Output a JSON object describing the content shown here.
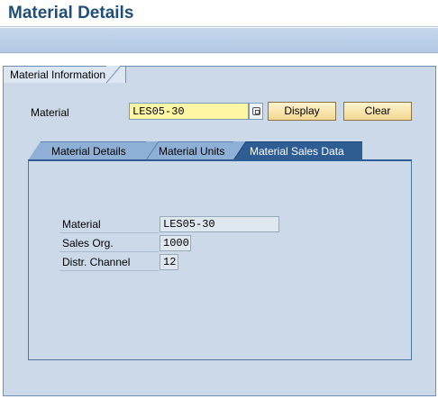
{
  "page": {
    "title": "Material Details"
  },
  "group": {
    "caption": "Material Information"
  },
  "material_field": {
    "label": "Material",
    "value": "LES05-30"
  },
  "buttons": {
    "display": "Display",
    "clear": "Clear"
  },
  "tabs": [
    {
      "label": "Material Details",
      "active": false
    },
    {
      "label": "Material Units",
      "active": false
    },
    {
      "label": "Material Sales Data",
      "active": true
    }
  ],
  "sales_data": {
    "rows": [
      {
        "label": "Material",
        "value": "LES05-30"
      },
      {
        "label": "Sales Org.",
        "value": "1000"
      },
      {
        "label": "Distr. Channel",
        "value": "12"
      }
    ]
  },
  "colors": {
    "title": "#1f4e79",
    "active_tab": "#2e5d93",
    "inactive_tab": "#8fb0d6",
    "panel_bg": "#cbd9e8",
    "input_highlight": "#fff7a6"
  },
  "icons": {
    "value_help": "value-help-icon"
  }
}
